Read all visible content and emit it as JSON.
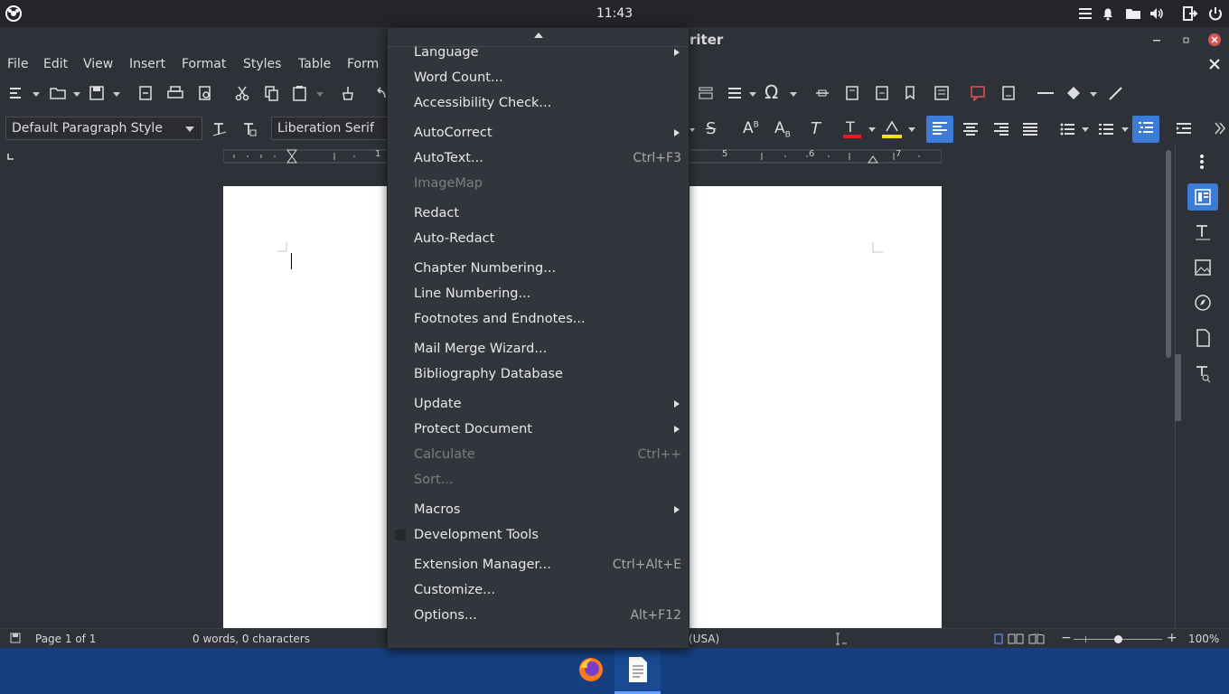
{
  "top_panel": {
    "clock": "11:43"
  },
  "window": {
    "title_fragment": "riter"
  },
  "menubar": {
    "items": [
      "File",
      "Edit",
      "View",
      "Insert",
      "Format",
      "Styles",
      "Table",
      "Form"
    ]
  },
  "toolbar": {
    "paragraph_style": "Default Paragraph Style",
    "font_name": "Liberation Serif"
  },
  "ruler": {
    "labels": [
      "1",
      "5",
      "6",
      "7"
    ]
  },
  "status": {
    "page": "Page 1 of 1",
    "words": "0 words, 0 characters",
    "language": "(USA)",
    "zoom": "100%"
  },
  "tools_menu": {
    "items": [
      {
        "label": "Language",
        "submenu": true
      },
      {
        "label": "Word Count..."
      },
      {
        "label": "Accessibility Check..."
      },
      {
        "label": "AutoCorrect",
        "submenu": true
      },
      {
        "label": "AutoText...",
        "shortcut": "Ctrl+F3"
      },
      {
        "label": "ImageMap",
        "disabled": true
      },
      {
        "label": "Redact"
      },
      {
        "label": "Auto-Redact"
      },
      {
        "label": "Chapter Numbering..."
      },
      {
        "label": "Line Numbering..."
      },
      {
        "label": "Footnotes and Endnotes..."
      },
      {
        "label": "Mail Merge Wizard..."
      },
      {
        "label": "Bibliography Database"
      },
      {
        "label": "Update",
        "submenu": true
      },
      {
        "label": "Protect Document",
        "submenu": true
      },
      {
        "label": "Calculate",
        "shortcut": "Ctrl++",
        "disabled": true
      },
      {
        "label": "Sort...",
        "disabled": true
      },
      {
        "label": "Macros",
        "submenu": true
      },
      {
        "label": "Development Tools",
        "checkbox": true
      },
      {
        "label": "Extension Manager...",
        "shortcut": "Ctrl+Alt+E"
      },
      {
        "label": "Customize..."
      },
      {
        "label": "Options...",
        "shortcut": "Alt+F12"
      }
    ]
  },
  "colors": {
    "panel": "#23252b",
    "window": "#2e3138",
    "accent": "#3d7cd6",
    "taskbar": "#153f80",
    "menu": "#33353c"
  }
}
